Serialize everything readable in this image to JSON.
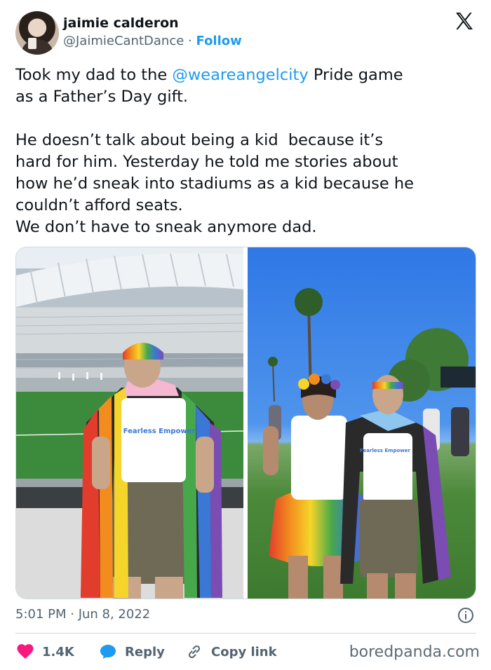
{
  "author": {
    "display_name": "jaimie calderon",
    "handle": "@JaimieCantDance",
    "separator": "·",
    "follow_label": "Follow"
  },
  "tweet": {
    "text_before_mention": "Took my dad to the ",
    "mention": "@weareangelcity",
    "text_after_mention": " Pride game\nas a Father’s Day gift.\n\nHe doesn’t talk about being a kid  because it’s\nhard for him. Yesterday he told me stories about\nhow he’d sneak into stadiums as a kid because he\ncouldn’t afford seats.\nWe don’t have to sneak anymore dad."
  },
  "media": {
    "left_shirt_text": "Fearless Empower",
    "right_shirt_text": "Fearless Empower"
  },
  "footer": {
    "timestamp": "5:01 PM · Jun 8, 2022",
    "likes": "1.4K",
    "reply_label": "Reply",
    "copy_label": "Copy link"
  },
  "watermark": "boredpanda.com",
  "colors": {
    "accent": "#1d9bf0",
    "like": "#f91880",
    "text": "#0f1419",
    "muted": "#536471"
  },
  "icons": [
    "x-logo-icon",
    "info-icon",
    "heart-icon",
    "reply-bubble-icon",
    "link-icon"
  ]
}
